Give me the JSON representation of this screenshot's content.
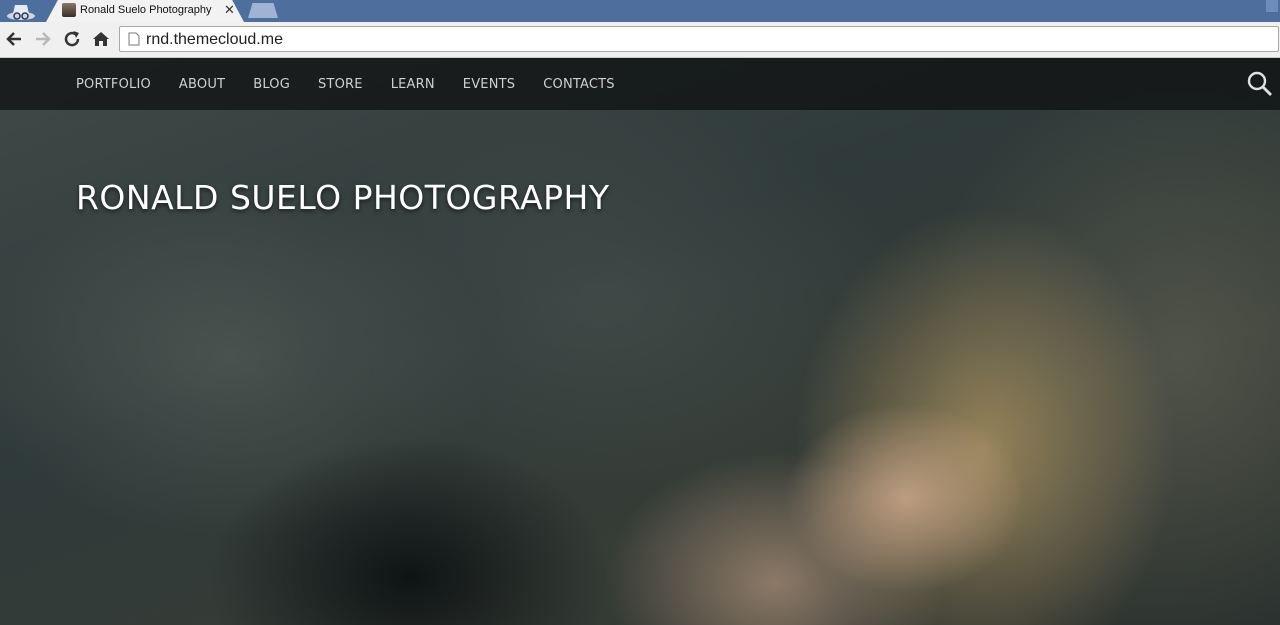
{
  "browser": {
    "tab_title": "Ronald Suelo Photography",
    "tab_close": "✕",
    "url": "rnd.themecloud.me"
  },
  "site": {
    "title": "RONALD SUELO PHOTOGRAPHY",
    "menu": [
      {
        "label": "PORTFOLIO"
      },
      {
        "label": "ABOUT"
      },
      {
        "label": "BLOG"
      },
      {
        "label": "STORE"
      },
      {
        "label": "LEARN"
      },
      {
        "label": "EVENTS"
      },
      {
        "label": "CONTACTS"
      }
    ]
  },
  "icons": {
    "incognito": "incognito-icon",
    "favicon": "site-favicon",
    "back": "back-arrow-icon",
    "forward": "forward-arrow-icon",
    "reload": "reload-icon",
    "home": "home-icon",
    "page": "page-icon",
    "search": "search-icon"
  },
  "colors": {
    "tabstrip": "#4e6e9e",
    "navbar": "#0c0e0f",
    "menu_text": "#d0d0d0",
    "title_text": "#ffffff"
  }
}
